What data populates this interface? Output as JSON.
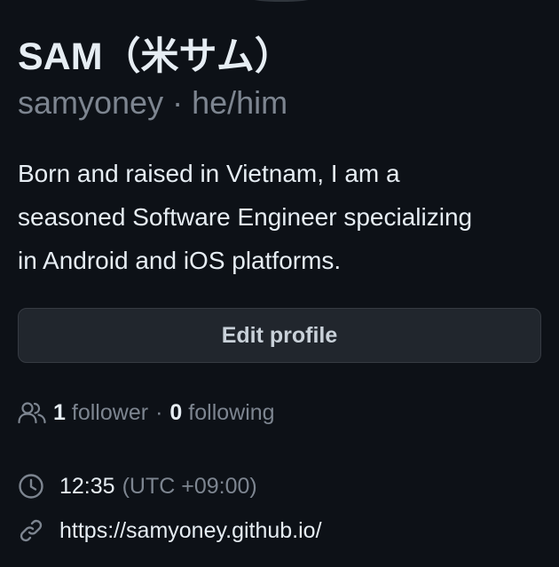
{
  "profile": {
    "display_name": "SAM（米サム）",
    "username": "samyoney",
    "separator": "·",
    "pronouns": "he/him",
    "bio_lines": [
      "Born and raised in Vietnam, I am a",
      "seasoned Software Engineer specializing",
      "in Android and iOS platforms."
    ],
    "edit_label": "Edit profile",
    "followers_count": "1",
    "followers_label": "follower",
    "following_count": "0",
    "following_label": "following",
    "local_time": "12:35",
    "timezone": "(UTC +09:00)",
    "website": "https://samyoney.github.io/"
  },
  "icons": {
    "followers": "people-icon",
    "time": "clock-icon",
    "website": "link-icon"
  },
  "colors": {
    "background": "#0d1117",
    "text_primary": "#e6edf3",
    "text_muted": "#7d8590",
    "button_bg": "#21262d",
    "button_border": "#363b42"
  }
}
